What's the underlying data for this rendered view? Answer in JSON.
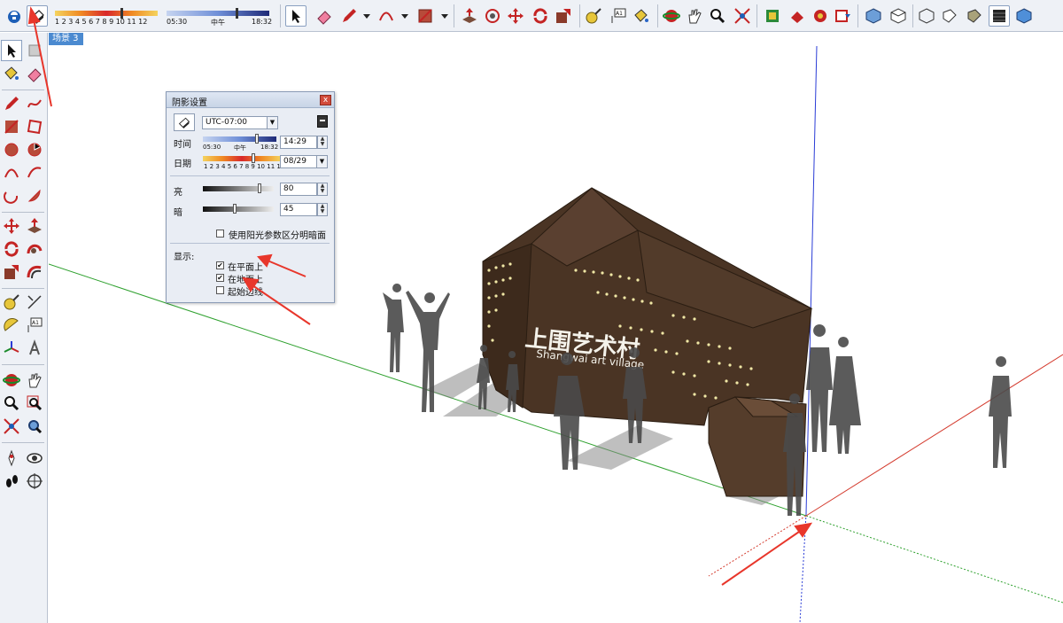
{
  "toolbar": {
    "time_slider": {
      "start_label": "05:30",
      "mid_label": "中午",
      "end_label": "18:32"
    },
    "date_slider": {
      "month_labels": "1 2 3 4 5 6 7 8 9 10 11 12"
    }
  },
  "scene_tab": {
    "label": "场景 3"
  },
  "shadow_dialog": {
    "title": "阴影设置",
    "close_label": "x",
    "timezone": "UTC-07:00",
    "time_label": "时间",
    "time_start": "05:30",
    "time_mid": "中午",
    "time_end": "18:32",
    "time_value": "14:29",
    "time_position": 0.73,
    "date_label": "日期",
    "date_months": "1 2 3 4 5 6 7 8 9 10 11 12",
    "date_value": "08/29",
    "date_position": 0.65,
    "light_label": "亮",
    "light_value": "80",
    "light_position": 0.8,
    "dark_label": "暗",
    "dark_value": "45",
    "dark_position": 0.45,
    "use_sun_label": "使用阳光参数区分明暗面",
    "use_sun_checked": false,
    "display_label": "显示:",
    "on_faces_label": "在平面上",
    "on_faces_checked": true,
    "on_ground_label": "在地面上",
    "on_ground_checked": true,
    "from_edges_label": "起始边线",
    "from_edges_checked": false
  },
  "model": {
    "sign_text_cn": "上围艺术村",
    "sign_text_en": "Shangwai art village"
  },
  "colors": {
    "toolbar_bg": "#eef1f6",
    "sign_brown": "#4a3424",
    "annotation_red": "#e8362b",
    "axis_green": "#2fa12f",
    "axis_red": "#d43b2e",
    "axis_blue": "#2a3cd6"
  }
}
